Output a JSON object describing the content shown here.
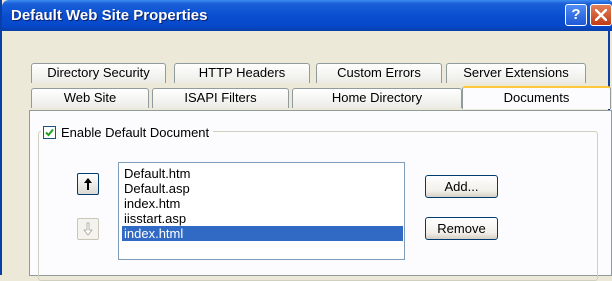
{
  "window": {
    "title": "Default Web Site Properties",
    "help_glyph": "?"
  },
  "tabs_row1": [
    {
      "label": "Directory Security"
    },
    {
      "label": "HTTP Headers"
    },
    {
      "label": "Custom Errors"
    },
    {
      "label": "Server Extensions"
    }
  ],
  "tabs_row2": [
    {
      "label": "Web Site"
    },
    {
      "label": "ISAPI Filters"
    },
    {
      "label": "Home Directory"
    },
    {
      "label": "Documents",
      "active": true
    }
  ],
  "default_document": {
    "enable_label": "Enable Default Document",
    "enabled": true,
    "move_up_glyph": "↑",
    "move_down_glyph": "↓",
    "documents": [
      "Default.htm",
      "Default.asp",
      "index.htm",
      "iisstart.asp",
      "index.html"
    ],
    "selected_index": 4,
    "add_label": "Add...",
    "remove_label": "Remove"
  },
  "colors": {
    "titlebar": "#0a4fd0",
    "selection": "#316ac5",
    "active_tab_accent": "#ffc83c",
    "dialog_bg": "#ece9d8"
  }
}
